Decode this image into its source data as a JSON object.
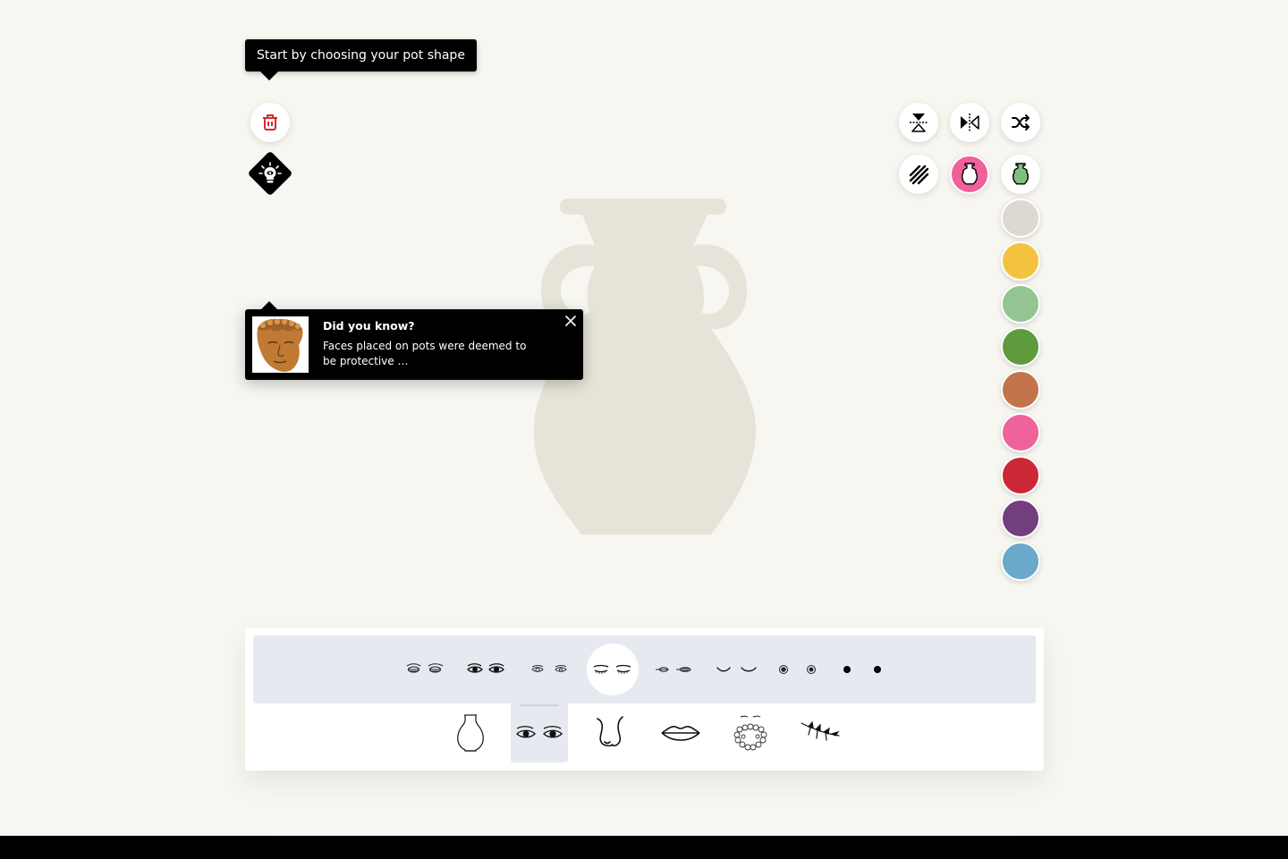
{
  "tooltip": {
    "text": "Start by choosing your pot shape"
  },
  "left_tools": [
    {
      "name": "delete",
      "icon": "trash-icon",
      "color": "#d9262e"
    },
    {
      "name": "hints",
      "icon": "lightbulb-eye-icon"
    }
  ],
  "right_tools": [
    {
      "name": "flip-vertical",
      "icon": "flip-vertical-icon"
    },
    {
      "name": "flip-horizontal",
      "icon": "flip-horizontal-icon"
    },
    {
      "name": "shuffle",
      "icon": "shuffle-icon"
    },
    {
      "name": "pattern",
      "icon": "hatch-pattern-icon"
    },
    {
      "name": "pot-outline-color",
      "icon": "vase-icon",
      "active": true,
      "color": "#f0609a"
    },
    {
      "name": "pot-fill-color",
      "icon": "vase-icon",
      "color": "#7fbf7f"
    }
  ],
  "palette": {
    "colors": [
      "#ddd8d0",
      "#f3c33f",
      "#93c492",
      "#5f9a3c",
      "#c2744a",
      "#ee6399",
      "#cc2735",
      "#733e7e",
      "#6aa9cb"
    ]
  },
  "pot": {
    "color": "#e6e3d8"
  },
  "did_you_know": {
    "title": "Did you know?",
    "body": "Faces placed on pots were deemed to be protective …",
    "close_label": "×"
  },
  "tray": {
    "variants": [
      {
        "label": "Eyes style 1"
      },
      {
        "label": "Eyes style 2"
      },
      {
        "label": "Eyes style 3"
      },
      {
        "label": "Eyes style 4 (closed)",
        "selected": true
      },
      {
        "label": "Eyes style 5"
      },
      {
        "label": "Eyes style 6"
      },
      {
        "label": "Eyes style 7"
      },
      {
        "label": "Eyes style 8"
      }
    ],
    "categories": [
      {
        "label": "Pot shape",
        "icon": "vase-outline-icon"
      },
      {
        "label": "Eyes",
        "icon": "eyes-icon",
        "selected": true
      },
      {
        "label": "Nose",
        "icon": "nose-icon"
      },
      {
        "label": "Mouth",
        "icon": "lips-icon"
      },
      {
        "label": "Hair & beard",
        "icon": "beard-icon"
      },
      {
        "label": "Decoration",
        "icon": "leaf-branch-icon"
      }
    ]
  }
}
